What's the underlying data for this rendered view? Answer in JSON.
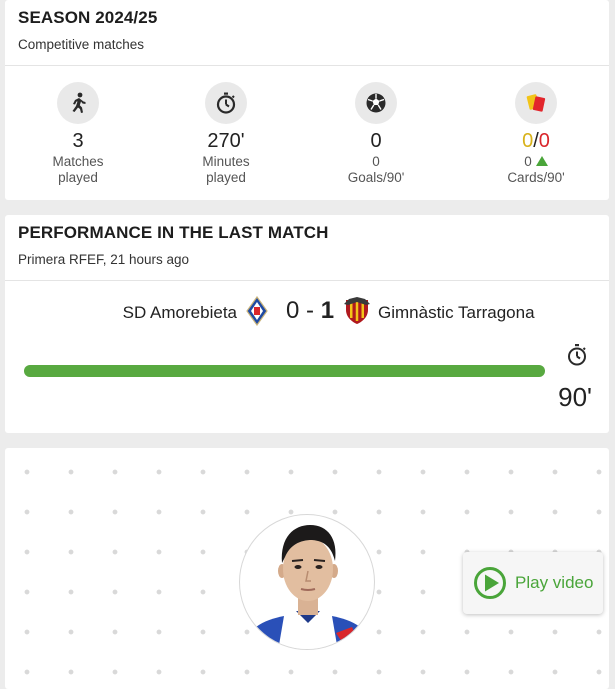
{
  "season": {
    "title": "SEASON 2024/25",
    "subtitle": "Competitive matches",
    "stats": {
      "matches": {
        "value": "3",
        "label_line1": "Matches",
        "label_line2": "played",
        "icon": "player-running-icon"
      },
      "minutes": {
        "value": "270'",
        "label_line1": "Minutes",
        "label_line2": "played",
        "icon": "stopwatch-icon"
      },
      "goals": {
        "value": "0",
        "label_line1": "0",
        "label_line2": "Goals/90'",
        "icon": "soccer-ball-icon"
      },
      "cards": {
        "yellow": "0",
        "separator": "/",
        "red": "0",
        "label_line1": "0",
        "label_line2": "Cards/90'",
        "icon": "cards-icon"
      }
    }
  },
  "performance": {
    "title": "PERFORMANCE IN THE LAST MATCH",
    "subtitle": "Primera RFEF, 21 hours ago",
    "home_team": "SD Amorebieta",
    "home_score": "0",
    "score_separator": "-",
    "away_score": "1",
    "away_team": "Gimnàstic Tarragona",
    "minutes_played": "90'",
    "minutes_fraction": 1.0
  },
  "video": {
    "play_label": "Play video"
  },
  "colors": {
    "accent_green": "#58a940",
    "yellow_card": "#d8b21a",
    "red_card": "#d9262b"
  }
}
